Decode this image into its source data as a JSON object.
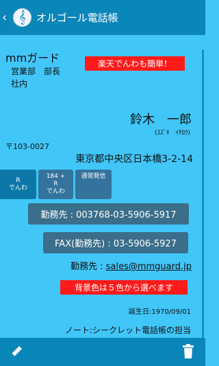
{
  "header": {
    "app_title": "オルゴール電話帳",
    "back_icon": "chevron-left-icon",
    "logo_icon": "music-note-icon"
  },
  "contact": {
    "company": "mmガード",
    "department": "営業部　部長",
    "location": "社内",
    "name": "鈴木　一郎",
    "name_reading": "(ｽｽﾞｷ　ｲﾁﾛｳ)",
    "postal_code": "〒103-0027",
    "address": "東京都中央区日本橋3-2-14",
    "work_phone": "勤務先 : 003768-03-5906-5917",
    "fax": "FAX(勤務先) : 03-5906-5927",
    "email_label": "勤務先 : ",
    "email": "sales@mmguard.jp",
    "birthday": "誕生日:1970/09/01",
    "note": "ノート:シークレット電話帳の担当"
  },
  "banners": {
    "promo": "楽天でんわも簡単！",
    "color_info": "背景色は５色から選べます"
  },
  "call_buttons": {
    "r_line1": "R",
    "r_line2": "でんわ",
    "prefix_line1": "184 +",
    "prefix_line2": "R",
    "prefix_line3": "でんわ",
    "normal": "通常発信"
  },
  "toolbar": {
    "edit_icon": "pencil-icon",
    "delete_icon": "trash-icon"
  },
  "colors": {
    "background": "#41c6f8",
    "bar": "#0a86b8",
    "banner_red": "#ff1b1b",
    "button_dark": "#3a6e8a"
  }
}
